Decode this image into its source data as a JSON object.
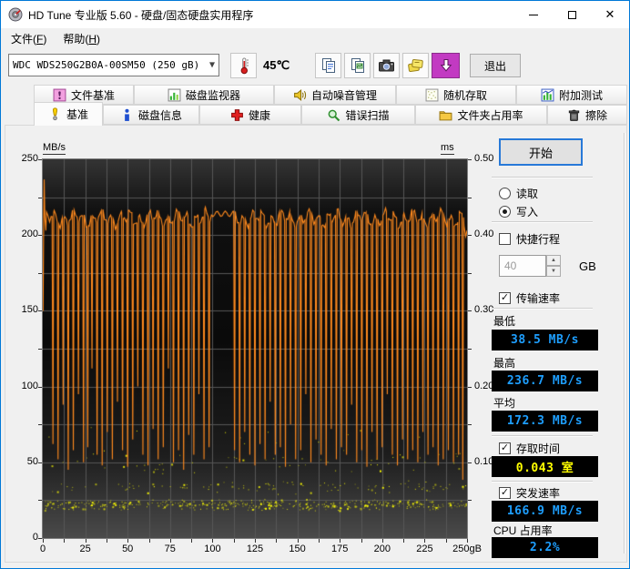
{
  "window": {
    "title": "HD Tune 专业版 5.60 - 硬盘/固态硬盘实用程序",
    "close_glyph": "✕"
  },
  "menu": {
    "file": {
      "pre": "文件(",
      "key": "F",
      "post": ")"
    },
    "help": {
      "pre": "帮助(",
      "key": "H",
      "post": ")"
    }
  },
  "toolbar": {
    "drive_selected": "WDC WDS250G2B0A-00SM50 (250 gB)",
    "temperature": "45℃",
    "exit": "退出",
    "icon_names": [
      "thermometer-icon",
      "copy-results-icon",
      "copy-image-icon",
      "camera-icon",
      "save-disks-icon",
      "download-icon"
    ]
  },
  "tabs": {
    "top": [
      {
        "label": "文件基准"
      },
      {
        "label": "磁盘监视器"
      },
      {
        "label": "自动噪音管理"
      },
      {
        "label": "随机存取"
      },
      {
        "label": "附加测试"
      }
    ],
    "bottom": [
      {
        "label": "基准",
        "active": true
      },
      {
        "label": "磁盘信息"
      },
      {
        "label": "健康"
      },
      {
        "label": "错误扫描"
      },
      {
        "label": "文件夹占用率"
      },
      {
        "label": "擦除"
      }
    ]
  },
  "panel": {
    "start": "开始",
    "read": "读取",
    "write": "写入",
    "short_stroke": "快捷行程",
    "short_stroke_value": "40",
    "short_stroke_unit": "GB",
    "transfer_rate": "传输速率",
    "min_label": "最低",
    "min_value": "38.5 MB/s",
    "max_label": "最高",
    "max_value": "236.7 MB/s",
    "avg_label": "平均",
    "avg_value": "172.3 MB/s",
    "access_time": "存取时间",
    "access_value": "0.043 室",
    "burst_rate": "突发速率",
    "burst_value": "166.9 MB/s",
    "cpu_label": "CPU 占用率",
    "cpu_value": "2.2%"
  },
  "chart_data": {
    "type": "line+scatter",
    "x": {
      "min": 0,
      "max": 250,
      "ticks": [
        [
          0,
          "0"
        ],
        [
          25,
          "25"
        ],
        [
          50,
          "50"
        ],
        [
          75,
          "75"
        ],
        [
          100,
          "100"
        ],
        [
          125,
          "125"
        ],
        [
          150,
          "150"
        ],
        [
          175,
          "175"
        ],
        [
          200,
          "200"
        ],
        [
          225,
          "225"
        ],
        [
          250,
          "250gB"
        ]
      ]
    },
    "y_left": {
      "label": "MB/s",
      "min": 0,
      "max": 250,
      "ticks": [
        [
          250,
          "250"
        ],
        [
          200,
          "200"
        ],
        [
          150,
          "150"
        ],
        [
          100,
          "100"
        ],
        [
          50,
          "50"
        ],
        [
          0,
          "0"
        ]
      ]
    },
    "y_right": {
      "label": "ms",
      "min": 0,
      "max": 0.5,
      "ticks": [
        [
          0.5,
          "0.50"
        ],
        [
          0.4,
          "0.40"
        ],
        [
          0.3,
          "0.30"
        ],
        [
          0.2,
          "0.20"
        ],
        [
          0.1,
          "0.10"
        ]
      ]
    },
    "grid_color": "#575757",
    "series": [
      {
        "name": "transfer-rate",
        "unit": "MB/s",
        "color": "#ff8a1e",
        "min": 38.5,
        "max": 236.7,
        "avg": 172.3,
        "baseline": 211,
        "wobble": 4,
        "flat_segment": [
          99,
          113
        ],
        "flat_value": 214,
        "start_points": [
          [
            0.15,
            150
          ],
          [
            0.5,
            205
          ],
          [
            0.8,
            236.7
          ],
          [
            1.2,
            212
          ],
          [
            1.8,
            203
          ]
        ],
        "end_points": [
          [
            248.2,
            206
          ],
          [
            249.2,
            199
          ],
          [
            250,
            203
          ]
        ],
        "dips": [
          [
            6,
            62
          ],
          [
            9,
            52
          ],
          [
            12,
            88
          ],
          [
            15,
            45
          ],
          [
            18,
            58
          ],
          [
            21,
            95
          ],
          [
            24,
            50
          ],
          [
            26.5,
            60
          ],
          [
            29,
            112
          ],
          [
            32,
            55
          ],
          [
            35,
            48
          ],
          [
            38,
            70
          ],
          [
            41,
            52
          ],
          [
            44,
            90
          ],
          [
            47,
            58
          ],
          [
            50,
            47
          ],
          [
            53,
            65
          ],
          [
            56,
            100
          ],
          [
            59,
            55
          ],
          [
            62,
            48
          ],
          [
            65,
            72
          ],
          [
            68,
            52
          ],
          [
            71,
            60
          ],
          [
            74,
            112
          ],
          [
            77,
            50
          ],
          [
            80,
            58
          ],
          [
            83,
            45
          ],
          [
            86,
            68
          ],
          [
            89,
            55
          ],
          [
            92,
            95
          ],
          [
            95,
            52
          ],
          [
            98,
            60
          ],
          [
            113,
            58
          ],
          [
            116,
            50
          ],
          [
            119,
            70
          ],
          [
            122,
            55
          ],
          [
            125,
            48
          ],
          [
            128,
            62
          ],
          [
            131,
            52
          ],
          [
            134,
            90
          ],
          [
            137,
            55
          ],
          [
            140,
            60
          ],
          [
            143,
            47
          ],
          [
            146,
            75
          ],
          [
            149,
            52
          ],
          [
            152,
            58
          ],
          [
            155,
            95
          ],
          [
            158,
            50
          ],
          [
            161,
            65
          ],
          [
            164,
            55
          ],
          [
            167,
            48
          ],
          [
            170,
            72
          ],
          [
            173,
            52
          ],
          [
            176,
            60
          ],
          [
            179,
            55
          ],
          [
            182,
            88
          ],
          [
            185,
            50
          ],
          [
            188,
            58
          ],
          [
            191,
            47
          ],
          [
            194,
            70
          ],
          [
            197,
            52
          ],
          [
            200,
            60
          ],
          [
            203,
            95
          ],
          [
            206,
            55
          ],
          [
            209,
            48
          ],
          [
            212,
            65
          ],
          [
            215,
            52
          ],
          [
            218,
            58
          ],
          [
            221,
            50
          ],
          [
            224,
            70
          ],
          [
            227,
            55
          ],
          [
            230,
            60
          ],
          [
            233,
            48
          ],
          [
            236,
            52
          ],
          [
            239,
            58
          ],
          [
            242,
            50
          ],
          [
            245,
            55
          ],
          [
            247.5,
            38.5
          ]
        ]
      },
      {
        "name": "access-time",
        "unit": "ms",
        "color": "#ffff00",
        "avg": 0.043,
        "bands": [
          {
            "y_min": 0.036,
            "y_max": 0.052,
            "count": 480
          },
          {
            "y_min": 0.058,
            "y_max": 0.078,
            "count": 110
          },
          {
            "y_min": 0.082,
            "y_max": 0.118,
            "count": 60
          },
          {
            "y_min": 0.122,
            "y_max": 0.148,
            "count": 12
          }
        ]
      }
    ]
  }
}
